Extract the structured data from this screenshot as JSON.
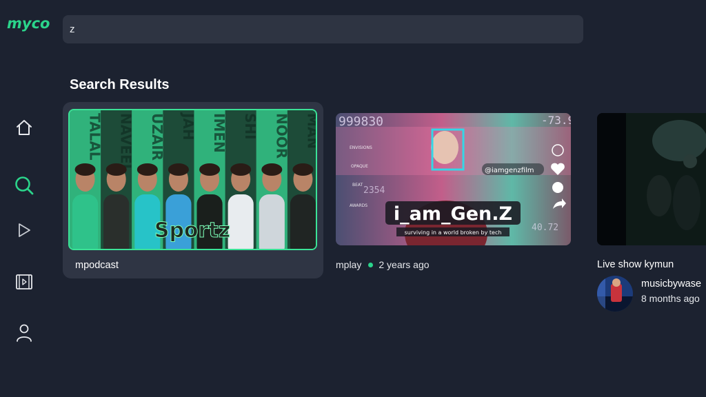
{
  "app": {
    "logo_text": "myco",
    "brand_color": "#2bd48b"
  },
  "search": {
    "value": "z"
  },
  "results_heading": "Search Results",
  "nav": {
    "items": [
      {
        "icon": "home-icon",
        "active": false
      },
      {
        "icon": "search-icon",
        "active": true
      },
      {
        "icon": "play-icon",
        "active": false
      },
      {
        "icon": "video-library-icon",
        "active": false
      },
      {
        "icon": "profile-icon",
        "active": false
      }
    ]
  },
  "results": [
    {
      "title": "mpodcast",
      "thumbnail_text": "Sportz",
      "thumbnail_column_names": [
        "TALAL",
        "NAVEEL",
        "UZAIR",
        "JAH",
        "IMEN",
        "SHI",
        "NOOR",
        "MAN"
      ],
      "selected": true
    },
    {
      "channel": "mplay",
      "age": "2 years ago",
      "thumbnail_title": "i_am_Gen.Z",
      "thumbnail_subtitle": "surviving in a world broken by tech",
      "thumbnail_handle": "@iamgenzfilm",
      "thumbnail_numbers": [
        "999830",
        "-73.9",
        "2354",
        "40.72"
      ],
      "thumbnail_laurels": [
        "ENVISIONS",
        "OPAQUE",
        "BEAT",
        "AWARDS"
      ]
    },
    {
      "title": "Live show kymun",
      "channel": "musicbywase",
      "age": "8 months ago"
    }
  ]
}
